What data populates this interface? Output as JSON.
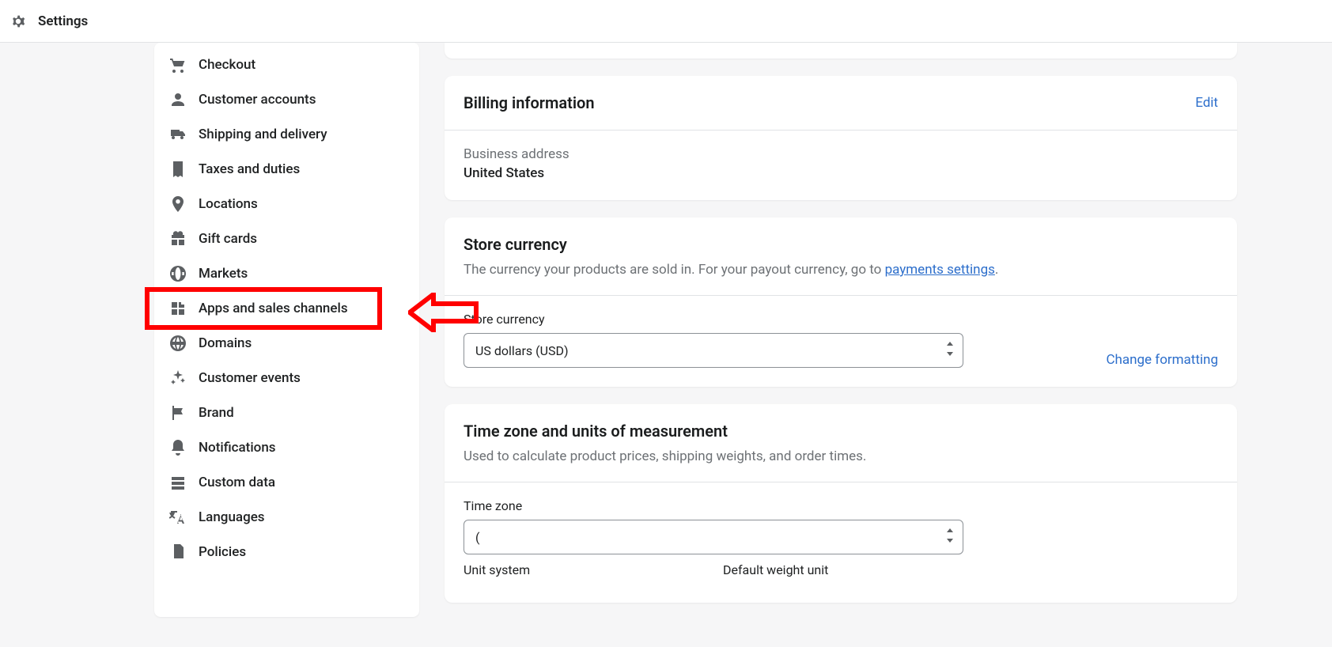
{
  "topbar": {
    "title": "Settings"
  },
  "sidebar": {
    "items": [
      {
        "label": "Checkout"
      },
      {
        "label": "Customer accounts"
      },
      {
        "label": "Shipping and delivery"
      },
      {
        "label": "Taxes and duties"
      },
      {
        "label": "Locations"
      },
      {
        "label": "Gift cards"
      },
      {
        "label": "Markets"
      },
      {
        "label": "Apps and sales channels"
      },
      {
        "label": "Domains"
      },
      {
        "label": "Customer events"
      },
      {
        "label": "Brand"
      },
      {
        "label": "Notifications"
      },
      {
        "label": "Custom data"
      },
      {
        "label": "Languages"
      },
      {
        "label": "Policies"
      }
    ]
  },
  "billing": {
    "title": "Billing information",
    "edit": "Edit",
    "address_label": "Business address",
    "address_value": "United States"
  },
  "currency": {
    "title": "Store currency",
    "desc_prefix": "The currency your products are sold in. For your payout currency, go to ",
    "desc_link": "payments settings",
    "desc_suffix": ".",
    "field_label": "Store currency",
    "value": "US dollars (USD)",
    "change_link": "Change formatting"
  },
  "tz": {
    "title": "Time zone and units of measurement",
    "desc": "Used to calculate product prices, shipping weights, and order times.",
    "tz_label": "Time zone",
    "tz_value": "(",
    "unit_label": "Unit system",
    "weight_label": "Default weight unit"
  }
}
